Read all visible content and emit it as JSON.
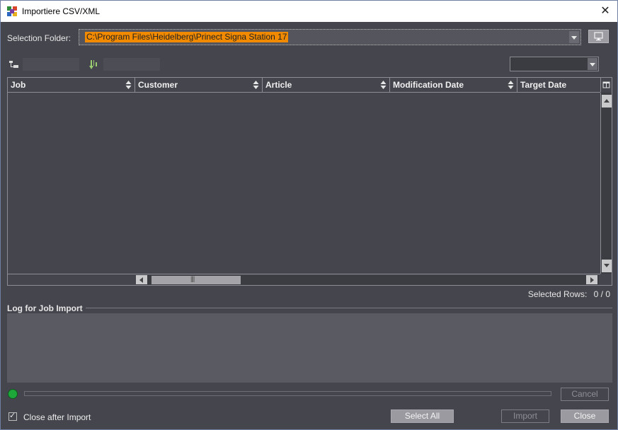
{
  "window": {
    "title": "Importiere CSV/XML",
    "close_glyph": "✕"
  },
  "selection": {
    "label": "Selection Folder:",
    "value": "C:\\Program Files\\Heidelberg\\Prinect Signa Station 17"
  },
  "table": {
    "columns": [
      "Job",
      "Customer",
      "Article",
      "Modification Date",
      "Target Date"
    ],
    "rows": []
  },
  "status": {
    "selected_rows_label": "Selected Rows:",
    "selected_rows_value": "0 / 0"
  },
  "log": {
    "title": "Log for Job Import"
  },
  "buttons": {
    "cancel": "Cancel",
    "select_all": "Select All",
    "import": "Import",
    "close": "Close"
  },
  "options": {
    "close_after_import_label": "Close after Import",
    "close_after_import_checked": true
  },
  "colors": {
    "accent_highlight": "#f28a00",
    "status_led": "#1fa83a",
    "panel_bg": "#45454d"
  }
}
